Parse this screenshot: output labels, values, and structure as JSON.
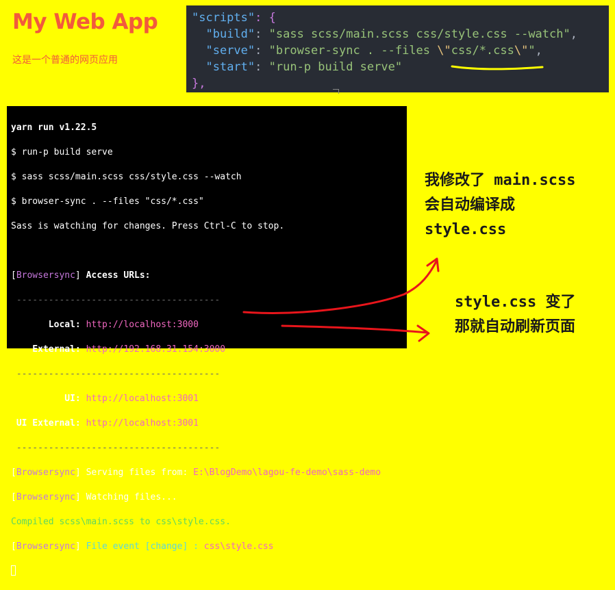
{
  "app": {
    "title": "My Web App",
    "subtitle": "这是一个普通的网页应用"
  },
  "code": {
    "line1": {
      "key": "\"scripts\"",
      "rest": ": {"
    },
    "line2": {
      "indent": "  ",
      "key": "\"build\"",
      "colon": ": ",
      "value": "\"sass scss/main.scss css/style.css --watch\"",
      "comma": ","
    },
    "line3": {
      "indent": "  ",
      "key": "\"serve\"",
      "colon": ": ",
      "value_a": "\"browser-sync . --files ",
      "esc1": "\\\"",
      "value_b": "css/*.css",
      "esc2": "\\\"",
      "value_c": "\"",
      "comma": ","
    },
    "line4": {
      "indent": "  ",
      "key": "\"start\"",
      "colon": ": ",
      "value": "\"run-p build serve\""
    },
    "line5": {
      "text": "},"
    }
  },
  "terminal": {
    "l1": "yarn run v1.22.5",
    "l2": "$ run-p build serve",
    "l3": "$ sass scss/main.scss css/style.css --watch",
    "l4": "$ browser-sync . --files \"css/*.css\"",
    "l5": "Sass is watching for changes. Press Ctrl-C to stop.",
    "bs_open": "[",
    "bs_name": "Browsersync",
    "bs_close": "]",
    "access_urls": " Access URLs:",
    "separator": " --------------------------------------",
    "local_label": "       Local: ",
    "local_url": "http://localhost:3000",
    "external_label": "    External: ",
    "external_url": "http://192.168.31.154:3000",
    "ui_label": "          UI: ",
    "ui_url": "http://localhost:3001",
    "ui_external_label": " UI External: ",
    "ui_external_url": "http://localhost:3001",
    "serving_label": " Serving files from: ",
    "serving_path": "E:\\BlogDemo\\lagou-fe-demo\\sass-demo",
    "watching": " Watching files...",
    "compiled": "Compiled scss\\main.scss to css\\style.css.",
    "file_event": " File event [change] : ",
    "file_event_path": "css\\style.css"
  },
  "notes": {
    "note1": "我修改了 main.scss\n会自动编译成\nstyle.css",
    "note2": "style.css 变了\n那就自动刷新页面"
  },
  "colors": {
    "background": "#ffff00",
    "title": "#f25a3c",
    "annotation": "#e8151b"
  }
}
